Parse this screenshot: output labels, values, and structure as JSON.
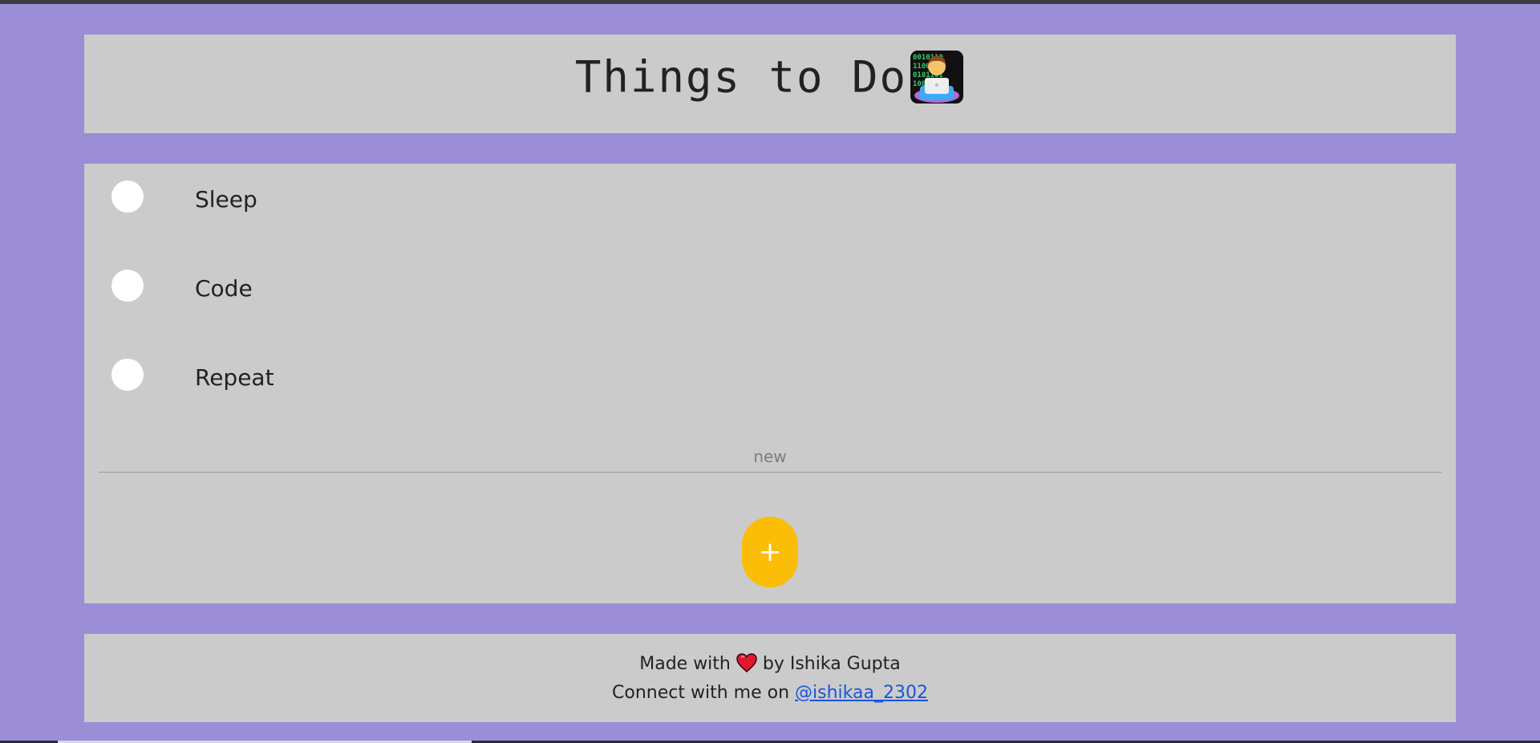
{
  "header": {
    "title": "Things to Do",
    "icon": "technologist-icon"
  },
  "tasks": [
    {
      "label": "Sleep",
      "checked": false
    },
    {
      "label": "Code",
      "checked": false
    },
    {
      "label": "Repeat",
      "checked": false
    }
  ],
  "new_item": {
    "placeholder": "new",
    "value": ""
  },
  "add_button": {
    "label": "+"
  },
  "footer": {
    "made_with_prefix": "Made with",
    "made_with_icon": "heart-icon",
    "made_with_suffix": "by Ishika Gupta",
    "connect_prefix": "Connect with me on",
    "handle": "@ishikaa_2302"
  },
  "colors": {
    "background": "#9b8dd6",
    "panel": "#cbcbcb",
    "add_button": "#fbbd08",
    "link": "#1a56db",
    "heart": "#e0182d"
  }
}
